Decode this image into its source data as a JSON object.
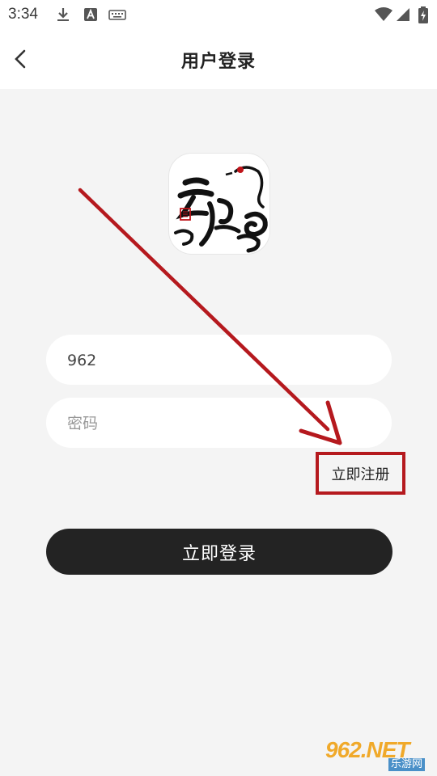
{
  "status_bar": {
    "time": "3:34",
    "icons": [
      "download-icon",
      "a-icon",
      "keyboard-icon",
      "wifi-icon",
      "signal-icon",
      "battery-icon"
    ]
  },
  "header": {
    "title": "用户登录",
    "back_icon": "chevron-left-icon"
  },
  "logo": {
    "name": "app-logo"
  },
  "form": {
    "username_value": "962",
    "password_placeholder": "密码",
    "register_label": "立即注册",
    "login_label": "立即登录"
  },
  "annotation": {
    "color": "#b5191e"
  },
  "watermark": {
    "main": "962.NET",
    "sub": "乐游网"
  }
}
